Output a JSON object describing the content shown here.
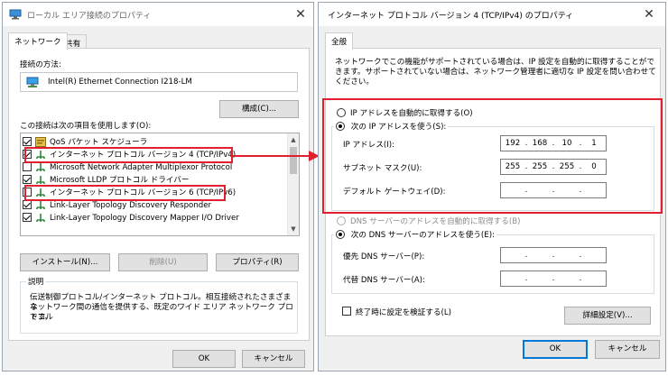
{
  "left_dialog": {
    "title": "ローカル エリア接続のプロパティ",
    "close_symbol": "✕",
    "tabs": [
      {
        "label": "ネットワーク"
      },
      {
        "label": "共有"
      }
    ],
    "connect_using_label": "接続の方法:",
    "adapter_name": "Intel(R) Ethernet Connection I218-LM",
    "configure_button": "構成(C)...",
    "items_label": "この接続は次の項目を使用します(O):",
    "items": [
      {
        "label": "QoS パケット スケジューラ",
        "checked": true,
        "icon": "qos-scheduler-icon"
      },
      {
        "label": "インターネット プロトコル バージョン 4 (TCP/IPv4)",
        "checked": true,
        "icon": "network-protocol-icon"
      },
      {
        "label": "Microsoft Network Adapter Multiplexor Protocol",
        "checked": false,
        "icon": "network-protocol-icon"
      },
      {
        "label": "Microsoft LLDP プロトコル ドライバー",
        "checked": true,
        "icon": "network-protocol-icon"
      },
      {
        "label": "インターネット プロトコル バージョン 6 (TCP/IPv6)",
        "checked": false,
        "icon": "network-protocol-icon"
      },
      {
        "label": "Link-Layer Topology Discovery Responder",
        "checked": true,
        "icon": "network-protocol-icon"
      },
      {
        "label": "Link-Layer Topology Discovery Mapper I/O Driver",
        "checked": true,
        "icon": "network-protocol-icon"
      }
    ],
    "install_button": "インストール(N)...",
    "uninstall_button": "削除(U)",
    "properties_button": "プロパティ(R)",
    "description_caption": "説明",
    "description_text_lines": [
      "伝送制御プロトコル/インターネット プロトコル。相互接続されたさまざまな",
      "ネットワーク間の通信を提供する、既定のワイド エリア ネットワーク プロトコル",
      "です。"
    ],
    "ok_button": "OK",
    "cancel_button": "キャンセル"
  },
  "right_dialog": {
    "title": "インターネット プロトコル バージョン 4 (TCP/IPv4) のプロパティ",
    "close_symbol": "✕",
    "tab": "全般",
    "intro_lines": [
      "ネットワークでこの機能がサポートされている場合は、IP 設定を自動的に取得することがで",
      "きます。サポートされていない場合は、ネットワーク管理者に適切な IP 設定を問い合わせて",
      "ください。"
    ],
    "auto_ip_option": "IP アドレスを自動的に取得する(O)",
    "manual_ip_option": "次の IP アドレスを使う(S):",
    "ip_selected_mode": "manual",
    "ip_address_label": "IP アドレス(I):",
    "ip_address": [
      "192",
      "168",
      "10",
      "1"
    ],
    "subnet_label": "サブネット マスク(U):",
    "subnet_mask": [
      "255",
      "255",
      "255",
      "0"
    ],
    "gateway_label": "デフォルト ゲートウェイ(D):",
    "gateway": [
      "",
      "",
      "",
      ""
    ],
    "auto_dns_option": "DNS サーバーのアドレスを自動的に取得する(B)",
    "manual_dns_option": "次の DNS サーバーのアドレスを使う(E):",
    "preferred_dns_label": "優先 DNS サーバー(P):",
    "preferred_dns": [
      "",
      "",
      "",
      ""
    ],
    "alternate_dns_label": "代替 DNS サーバー(A):",
    "alternate_dns": [
      "",
      "",
      "",
      ""
    ],
    "validate_on_exit_label": "終了時に設定を検証する(L)",
    "validate_on_exit_checked": false,
    "advanced_button": "詳細設定(V)...",
    "ok_button": "OK",
    "cancel_button": "キャンセル"
  },
  "annotation_color": "#e0202f"
}
